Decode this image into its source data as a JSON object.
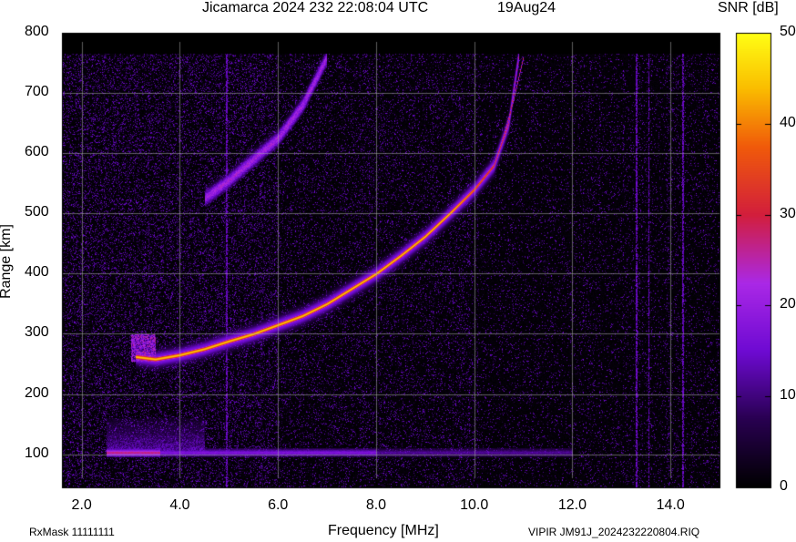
{
  "header": {
    "title": "Jicamarca 2024 232 22:08:04 UTC",
    "date": "19Aug24"
  },
  "footer": {
    "rxmask": "RxMask 11111111",
    "file": "VIPIR  JM91J_2024232220804.RIQ"
  },
  "chart_data": {
    "type": "heatmap",
    "title": "Jicamarca 2024 232 22:08:04 UTC",
    "xlabel": "Frequency [MHz]",
    "ylabel": "Range [km]",
    "colorbar_label": "SNR [dB]",
    "xlim": [
      1.6,
      15.0
    ],
    "ylim": [
      45,
      800
    ],
    "data_top_range_km": 765,
    "x_ticks": [
      "2.0",
      "4.0",
      "6.0",
      "8.0",
      "10.0",
      "12.0",
      "14.0"
    ],
    "x_tick_values": [
      2,
      4,
      6,
      8,
      10,
      12,
      14
    ],
    "y_ticks": [
      "100",
      "200",
      "300",
      "400",
      "500",
      "600",
      "700",
      "800"
    ],
    "y_tick_values": [
      100,
      200,
      300,
      400,
      500,
      600,
      700,
      800
    ],
    "colorbar_ticks": [
      "0",
      "10",
      "20",
      "30",
      "40",
      "50"
    ],
    "colorbar_tick_values": [
      0,
      10,
      20,
      30,
      40,
      50
    ],
    "colorbar_range": [
      0,
      50
    ],
    "grid": true,
    "traces": [
      {
        "label": "F-layer ordinary trace",
        "points": [
          [
            3.1,
            262
          ],
          [
            3.5,
            258
          ],
          [
            4.0,
            265
          ],
          [
            4.5,
            275
          ],
          [
            5.0,
            288
          ],
          [
            5.5,
            300
          ],
          [
            6.0,
            315
          ],
          [
            6.5,
            330
          ],
          [
            7.0,
            350
          ],
          [
            7.5,
            375
          ],
          [
            8.0,
            400
          ],
          [
            8.5,
            430
          ],
          [
            9.0,
            462
          ],
          [
            9.5,
            500
          ],
          [
            10.0,
            540
          ],
          [
            10.4,
            580
          ],
          [
            10.7,
            650
          ],
          [
            10.9,
            760
          ]
        ],
        "snr_db": 42
      },
      {
        "label": "second trace",
        "points": [
          [
            10.4,
            580
          ],
          [
            10.6,
            630
          ],
          [
            10.8,
            690
          ],
          [
            11.0,
            760
          ]
        ],
        "snr_db": 30
      },
      {
        "label": "multi-hop echo",
        "points": [
          [
            4.5,
            525
          ],
          [
            5.0,
            555
          ],
          [
            5.5,
            590
          ],
          [
            6.0,
            625
          ],
          [
            6.5,
            680
          ],
          [
            7.0,
            760
          ]
        ],
        "snr_db": 20
      },
      {
        "label": "E-region echoes",
        "freq_range": [
          2.5,
          12.0
        ],
        "range_km": [
          95,
          150
        ],
        "snr_db": 14
      }
    ]
  }
}
